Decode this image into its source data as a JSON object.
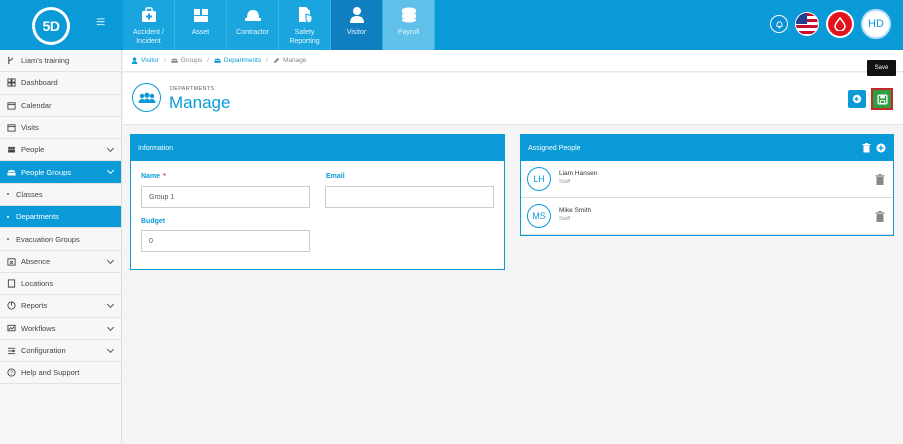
{
  "brand": {
    "logo_text": "5D"
  },
  "modules": [
    {
      "label": "Accident / Incident",
      "icon": "medical-kit-icon"
    },
    {
      "label": "Asset",
      "icon": "boxes-icon"
    },
    {
      "label": "Contractor",
      "icon": "hard-hat-icon"
    },
    {
      "label": "Safety Reporting",
      "icon": "report-shield-icon"
    },
    {
      "label": "Visitor",
      "icon": "person-icon"
    },
    {
      "label": "Payroll",
      "icon": "coins-icon"
    }
  ],
  "user": {
    "initials": "HD"
  },
  "sidebar": {
    "items": [
      {
        "label": "Liam's training",
        "icon": "branch-icon"
      },
      {
        "label": "Dashboard",
        "icon": "dashboard-icon"
      },
      {
        "label": "Calendar",
        "icon": "calendar-icon"
      },
      {
        "label": "Visits",
        "icon": "calendar-check-icon"
      },
      {
        "label": "People",
        "icon": "people-icon"
      },
      {
        "label": "People Groups",
        "icon": "people-group-icon"
      },
      {
        "label": "Classes"
      },
      {
        "label": "Departments"
      },
      {
        "label": "Evacuation Groups"
      },
      {
        "label": "Absence",
        "icon": "absence-icon"
      },
      {
        "label": "Locations",
        "icon": "building-icon"
      },
      {
        "label": "Reports",
        "icon": "chart-pie-icon"
      },
      {
        "label": "Workflows",
        "icon": "workflow-icon"
      },
      {
        "label": "Configuration",
        "icon": "sliders-icon"
      },
      {
        "label": "Help and Support",
        "icon": "help-icon"
      }
    ]
  },
  "breadcrumb": {
    "items": [
      "Visitor",
      "Groups",
      "Departments",
      "Manage"
    ]
  },
  "header": {
    "subtitle": "DEPARTMENTS",
    "title": "Manage"
  },
  "tooltip": {
    "text": "Save"
  },
  "info": {
    "title": "Information",
    "name_label": "Name",
    "name_required": "*",
    "name_value": "Group 1",
    "email_label": "Email",
    "email_value": "",
    "budget_label": "Budget",
    "budget_value": "0"
  },
  "assigned": {
    "title": "Assigned People",
    "people": [
      {
        "initials": "LH",
        "name": "Liam Hansen",
        "role": "Staff"
      },
      {
        "initials": "MS",
        "name": "Mike Smith",
        "role": "Staff"
      }
    ]
  },
  "colors": {
    "primary": "#0b9ad8",
    "save_green": "#2e9e45",
    "alert_red": "#e4121a"
  }
}
